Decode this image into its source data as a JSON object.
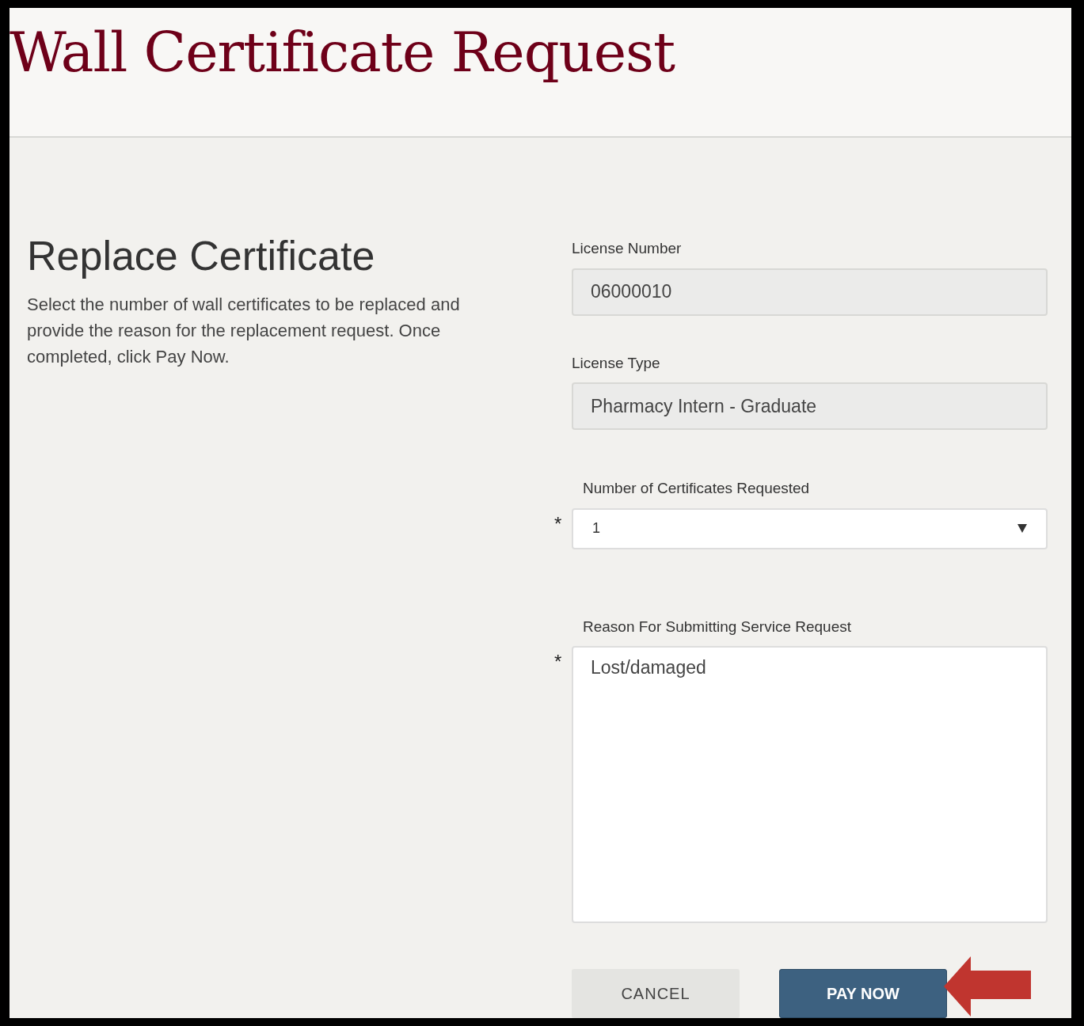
{
  "page_title": "Wall Certificate Request",
  "section": {
    "heading": "Replace Certificate",
    "description": "Select the number of wall certificates to be replaced and provide the reason for the replacement request. Once completed, click Pay Now."
  },
  "fields": [
    {
      "kind": "readonly",
      "label": "License Number",
      "value": "06000010"
    },
    {
      "kind": "readonly",
      "label": "License Type",
      "value": "Pharmacy Intern - Graduate"
    },
    {
      "kind": "select",
      "label": "Number of Certificates Requested",
      "value": "1",
      "required_mark": "*"
    },
    {
      "kind": "textarea",
      "label": "Reason For Submitting Service Request",
      "value": "Lost/damaged",
      "required_mark": "*"
    }
  ],
  "buttons": [
    {
      "kind": "secondary",
      "label": "CANCEL"
    },
    {
      "kind": "primary",
      "label": "PAY NOW",
      "highlighted": true
    }
  ]
}
